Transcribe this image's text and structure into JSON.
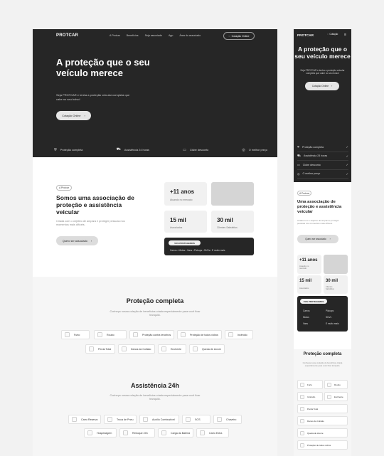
{
  "brand": {
    "logo": "PROTCAR"
  },
  "desktop": {
    "nav": {
      "links": [
        "A Protcar",
        "Benefícios",
        "Seja associado",
        "App",
        "Área do associado"
      ],
      "cta": "Cotação Online"
    },
    "hero": {
      "title": "A proteção que o seu veículo merece",
      "subtitle": "Seja PROTCAR e tenha a proteção veicular completa que cabe no seu bolso!",
      "button": "Cotação Online",
      "features": [
        "Proteção completa",
        "Assistência 24 horas",
        "Clube desconto",
        "O melhor preço"
      ]
    },
    "about": {
      "badge": "A Protcar",
      "title": "Somos uma associação de proteção e assistência veicular",
      "text": "Criada com o objetivo de ampara e proteger pessoas nos momentos mais difíceis.",
      "button": "Quero ser associado",
      "stats": [
        {
          "value": "+11 anos",
          "label": "Atuando no mercado"
        },
        {
          "value": "15 mil",
          "label": "Associados"
        },
        {
          "value": "30 mil",
          "label": "Clientes Satisfeitos"
        }
      ],
      "protect_tag": "VOS PROTEGEMOS",
      "protect_items": "Carros • Motos • Vans • Pickups • SUVs • E muito mais"
    },
    "protecao": {
      "title": "Proteção completa",
      "subtitle": "Conheça nossa coleção de benefícios criada especialmente para você ficar tranquilo.",
      "items_row1": [
        "Furto",
        "Roubo",
        "Proteção contra terceiros",
        "Proteção de todos vidros",
        "Incêndio"
      ],
      "items_row2": [
        "Perda Total",
        "Danos da Colisão",
        "Enchente",
        "Queda de árvore"
      ]
    },
    "assistencia": {
      "title": "Assistência 24h",
      "subtitle": "Conheça nossa coleção de benefícios criada especialmente para você ficar tranquilo.",
      "items_row1": [
        "Carro Reserva",
        "Troca de Pneu",
        "Auxílio Combustível",
        "SOS",
        "Chaveiro"
      ],
      "items_row2": [
        "Hospedagem",
        "Reboque 24h",
        "Carga da Bateria",
        "Carro Extra"
      ]
    }
  },
  "mobile": {
    "nav": {
      "cta": "Cotação",
      "menu_icon": "menu-icon"
    },
    "hero": {
      "title": "A proteção que o seu veículo merece",
      "subtitle": "Seja PROTCAR e tenha a proteção veicular completa que cabe no seu bolso!",
      "button": "Cotação Online",
      "features": [
        "Proteção completa",
        "Assistência 24 horas",
        "Clube desconto",
        "O melhor preço"
      ]
    },
    "about": {
      "badge": "A Protcar",
      "title": "Uma associação de proteção e assistência veicular",
      "text": "Criada com o objetivo de ampara e proteger pessoas nos momentos mais difíceis.",
      "button": "Quero ser associado",
      "stats": [
        {
          "value": "+11 anos",
          "label": "Atuando no mercado"
        },
        {
          "value": "15 mil",
          "label": "Associados"
        },
        {
          "value": "30 mil",
          "label": "Clientes Satisfeitos"
        }
      ],
      "protect_tag": "VOS PROTEGEMOS",
      "protect_items": [
        "Carros",
        "Motos",
        "Vans",
        "Pickups",
        "SUVs",
        "E muito mais"
      ]
    },
    "protecao": {
      "title": "Proteção completa",
      "subtitle": "Conheça nossa coleção de benefícios criada especialmente para você ficar tranquilo.",
      "items": [
        "Furto",
        "Roubo",
        "Incêndio",
        "Enchente",
        "Perda Total",
        "Danos da Colisão",
        "Queda de árvore",
        "Proteção de todos vidros"
      ]
    }
  },
  "colors": {
    "dark": "#262626",
    "light": "#f6f6f6",
    "accent": "#dcdcdc"
  }
}
